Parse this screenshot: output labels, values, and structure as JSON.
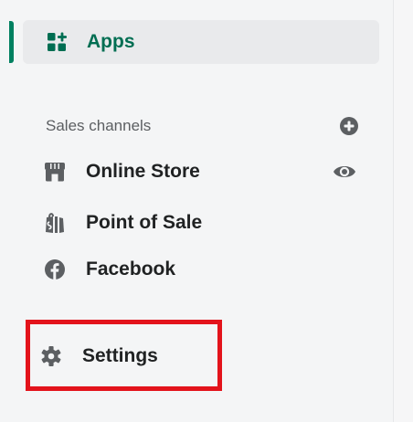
{
  "nav": {
    "apps": {
      "label": "Apps",
      "icon": "apps-grid-plus-icon",
      "selected": true,
      "accent": "#008060"
    }
  },
  "sales_channels": {
    "header": "Sales channels",
    "add_icon": "plus-circle-icon",
    "items": [
      {
        "label": "Online Store",
        "icon": "store-icon",
        "action_icon": "eye-icon"
      },
      {
        "label": "Point of Sale",
        "icon": "shopping-bag-icon"
      },
      {
        "label": "Facebook",
        "icon": "facebook-icon"
      }
    ]
  },
  "settings": {
    "label": "Settings",
    "icon": "gear-icon",
    "highlight_color": "#e3131b"
  }
}
